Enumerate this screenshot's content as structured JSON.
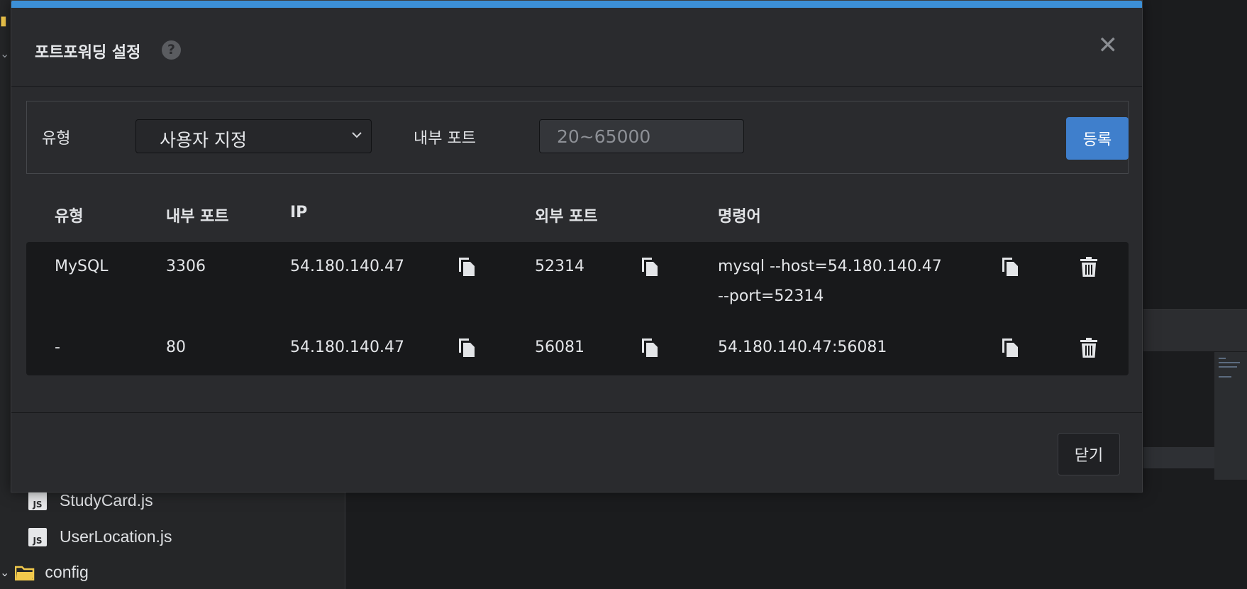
{
  "sidebar": {
    "files": [
      {
        "name": "StudyCard.js",
        "badge": "JS"
      },
      {
        "name": "UserLocation.js",
        "badge": "JS"
      }
    ],
    "folder": {
      "name": "config"
    }
  },
  "modal": {
    "title": "포트포워딩 설정",
    "help_label": "?",
    "close_glyph": "✕",
    "form": {
      "type_label": "유형",
      "type_selected": "사용자 지정",
      "port_label": "내부 포트",
      "port_placeholder": "20~65000",
      "register_label": "등록"
    },
    "table": {
      "headers": [
        "유형",
        "내부 포트",
        "IP",
        "외부 포트",
        "명령어"
      ],
      "rows": [
        {
          "type": "MySQL",
          "internal_port": "3306",
          "ip": "54.180.140.47",
          "external_port": "52314",
          "command_line1": "mysql --host=54.180.140.47",
          "command_line2": "--port=52314"
        },
        {
          "type": "-",
          "internal_port": "80",
          "ip": "54.180.140.47",
          "external_port": "56081",
          "command_line1": "54.180.140.47:56081",
          "command_line2": ""
        }
      ]
    },
    "footer": {
      "close_label": "닫기"
    }
  },
  "colors": {
    "accent": "#3c8fd6",
    "primary_button": "#3f7fcc",
    "folder": "#f2c94c"
  },
  "icons": [
    "help-icon",
    "close-icon",
    "chevron-down-icon",
    "copy-icon",
    "trash-icon",
    "js-file-icon",
    "folder-icon"
  ]
}
